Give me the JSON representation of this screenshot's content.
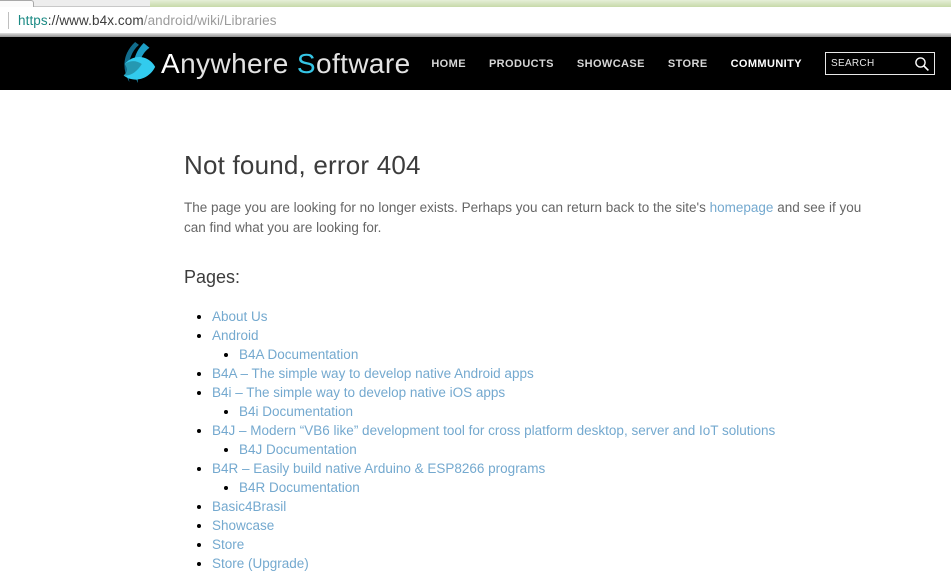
{
  "browser": {
    "url_scheme": "https",
    "url_host": "://www.b4x.com",
    "url_path": "/android/wiki/Libraries"
  },
  "header": {
    "logo": {
      "word1_initial": "A",
      "word1_rest": "nywhere ",
      "word2_initial": "S",
      "word2_rest": "oftware"
    },
    "nav": {
      "items": [
        {
          "label": "HOME"
        },
        {
          "label": "PRODUCTS"
        },
        {
          "label": "SHOWCASE"
        },
        {
          "label": "STORE"
        },
        {
          "label": "COMMUNITY"
        }
      ]
    },
    "search_placeholder": "SEARCH"
  },
  "main": {
    "title": "Not found, error 404",
    "body_before": "The page you are looking for no longer exists. Perhaps you can return back to the site's ",
    "body_link": "homepage",
    "body_after": " and see if you can find what you are looking for.",
    "pages_heading": "Pages:",
    "pages": [
      {
        "label": "About Us"
      },
      {
        "label": "Android",
        "children": [
          "B4A Documentation"
        ]
      },
      {
        "label": "B4A – The simple way to develop native Android apps"
      },
      {
        "label": "B4i – The simple way to develop native iOS apps",
        "children": [
          "B4i Documentation"
        ]
      },
      {
        "label": "B4J – Modern “VB6 like” development tool for cross platform desktop, server and IoT solutions",
        "children": [
          "B4J Documentation"
        ]
      },
      {
        "label": "B4R – Easily build native Arduino & ESP8266 programs",
        "children": [
          "B4R Documentation"
        ]
      },
      {
        "label": "Basic4Brasil"
      },
      {
        "label": "Showcase"
      },
      {
        "label": "Store"
      },
      {
        "label": "Store (Upgrade)"
      }
    ]
  },
  "colors": {
    "header_bg": "#000000",
    "link_blue": "#74a9cf",
    "accent_cyan": "#35c4e4",
    "url_scheme_teal": "#1b8a84",
    "tab_strip_green": "#c7d9a9"
  }
}
